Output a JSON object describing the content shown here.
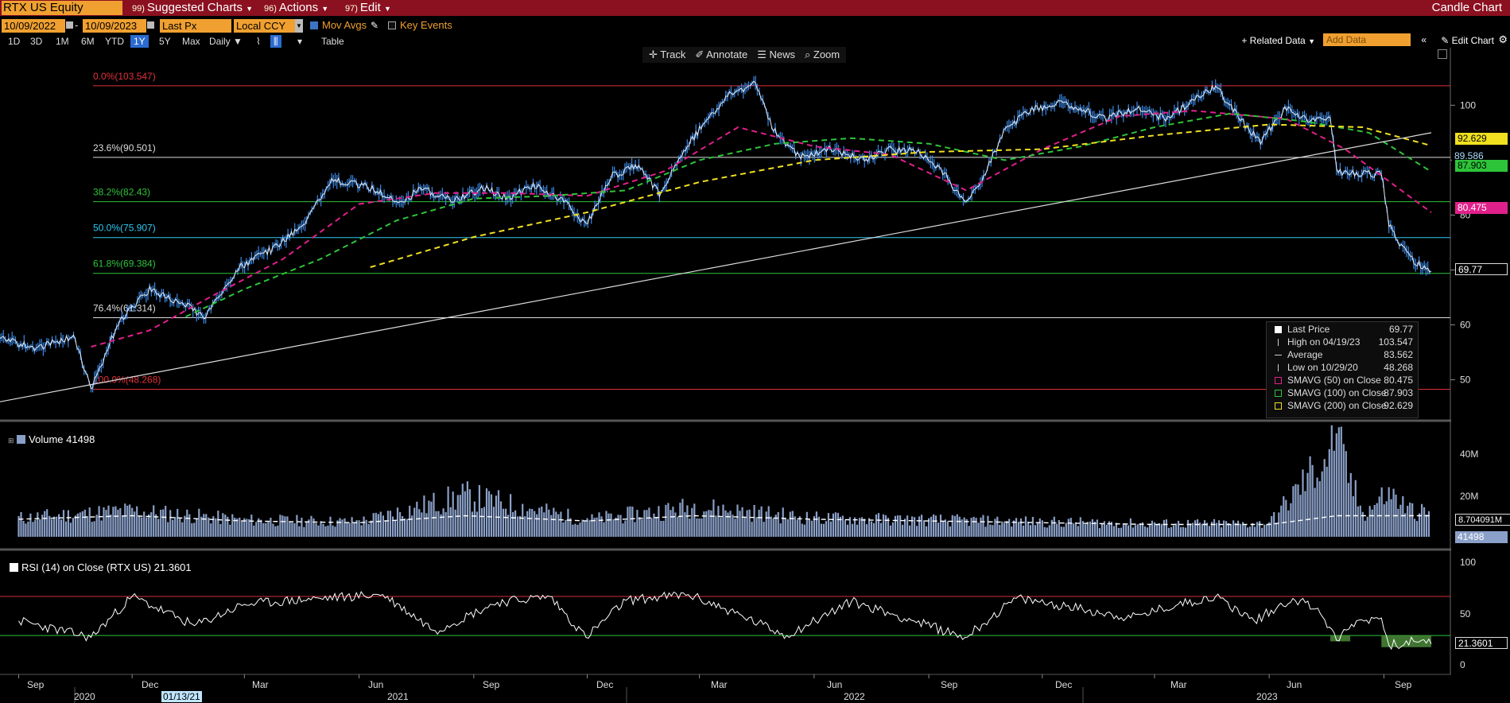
{
  "toolbar": {
    "ticker": "RTX US Equity",
    "menus": [
      {
        "num": "99)",
        "label": "Suggested Charts"
      },
      {
        "num": "96)",
        "label": "Actions"
      },
      {
        "num": "97)",
        "label": "Edit"
      }
    ],
    "chart_type": "Candle Chart",
    "start_date": "10/09/2022",
    "end_date": "10/09/2023",
    "price_field": "Last Px",
    "currency": "Local CCY",
    "mov_avgs": "Mov Avgs",
    "key_events": "Key Events",
    "periods": [
      "1D",
      "3D",
      "1M",
      "6M",
      "YTD",
      "1Y",
      "5Y",
      "Max"
    ],
    "selected_period": "1Y",
    "frequency": "Daily",
    "table_label": "Table",
    "related_data": "+ Related Data",
    "add_data_placeholder": "Add Data",
    "edit_chart": "Edit Chart",
    "tools": [
      "Track",
      "Annotate",
      "News",
      "Zoom"
    ]
  },
  "legend": {
    "rows": [
      {
        "label": "Last Price",
        "value": "69.77",
        "color": "#ffffff"
      },
      {
        "label": "High on 04/19/23",
        "value": "103.547",
        "color": "#cccccc"
      },
      {
        "label": "Average",
        "value": "83.562",
        "color": "#cccccc"
      },
      {
        "label": "Low on 10/29/20",
        "value": "48.268",
        "color": "#cccccc"
      },
      {
        "label": "SMAVG (50)  on Close",
        "value": "80.475",
        "color": "#e0208a"
      },
      {
        "label": "SMAVG (100)  on Close",
        "value": "87.903",
        "color": "#2ec43a"
      },
      {
        "label": "SMAVG (200)  on Close",
        "value": "92.629",
        "color": "#f0e020"
      }
    ]
  },
  "price_tags": [
    {
      "label": "92.629",
      "bg": "#f0e020",
      "fg": "#000000"
    },
    {
      "label": "89.586",
      "bg": "#000000",
      "fg": "#aaddff"
    },
    {
      "label": "87.903",
      "bg": "#2ec43a",
      "fg": "#000000"
    },
    {
      "label": "80.475",
      "bg": "#e0208a",
      "fg": "#ffffff"
    },
    {
      "label": "69.77",
      "bg": "#000000",
      "fg": "#ffffff"
    }
  ],
  "volume_panel": {
    "label": "Volume  41498",
    "tags": [
      "8.704091M",
      "41498"
    ],
    "yticks": [
      "40M",
      "20M"
    ]
  },
  "rsi_panel": {
    "label": "RSI (14)  on Close (RTX US) 21.3601",
    "tag": "21.3601",
    "yticks": [
      "100",
      "50",
      "0"
    ]
  },
  "x_axis": {
    "months": [
      "Sep",
      "Dec",
      "Mar",
      "Jun",
      "Sep",
      "Dec",
      "Mar",
      "Jun",
      "Sep",
      "Dec",
      "Mar",
      "Jun",
      "Sep"
    ],
    "years": [
      "2020",
      "2021",
      "2022",
      "2023"
    ],
    "highlight": "01/13/21"
  },
  "chart_data": {
    "type": "line",
    "title": "RTX US Equity",
    "y_axis_ticks": [
      100,
      90,
      80,
      70,
      60,
      50
    ],
    "ylim": [
      44,
      107
    ],
    "x_range": [
      "2020-08-17",
      "2023-10-09"
    ],
    "price_series": {
      "name": "Last Price",
      "dates": [
        "2020-08-17",
        "2020-09-15",
        "2020-10-15",
        "2020-10-29",
        "2020-11-20",
        "2020-12-15",
        "2021-01-13",
        "2021-01-29",
        "2021-02-25",
        "2021-03-25",
        "2021-04-20",
        "2021-05-10",
        "2021-06-10",
        "2021-07-05",
        "2021-07-20",
        "2021-08-15",
        "2021-09-10",
        "2021-09-28",
        "2021-10-20",
        "2021-11-15",
        "2021-11-30",
        "2021-12-20",
        "2022-01-10",
        "2022-01-28",
        "2022-02-15",
        "2022-03-01",
        "2022-03-25",
        "2022-04-15",
        "2022-04-28",
        "2022-05-20",
        "2022-06-15",
        "2022-07-10",
        "2022-08-01",
        "2022-08-25",
        "2022-09-15",
        "2022-09-30",
        "2022-10-15",
        "2022-10-31",
        "2022-11-20",
        "2022-12-15",
        "2022-12-30",
        "2023-01-20",
        "2023-02-15",
        "2023-03-10",
        "2023-04-19",
        "2023-05-10",
        "2023-05-25",
        "2023-06-15",
        "2023-07-05",
        "2023-07-20",
        "2023-07-25",
        "2023-08-10",
        "2023-08-30",
        "2023-09-05",
        "2023-09-12",
        "2023-09-25",
        "2023-10-09"
      ],
      "values": [
        57.5,
        55.8,
        57.8,
        48.3,
        60.5,
        66.5,
        63.5,
        61.5,
        70.5,
        74.0,
        79.0,
        86.5,
        85.0,
        82.0,
        85.0,
        82.5,
        85.0,
        83.0,
        85.5,
        82.0,
        78.0,
        87.0,
        89.0,
        84.0,
        91.0,
        95.5,
        102.0,
        104.0,
        96.0,
        90.5,
        92.0,
        90.0,
        92.0,
        91.5,
        87.0,
        82.0,
        87.0,
        95.0,
        99.0,
        100.5,
        99.5,
        97.5,
        99.5,
        97.5,
        103.5,
        97.0,
        93.5,
        99.5,
        97.0,
        98.0,
        88.0,
        87.5,
        87.5,
        78.5,
        75.0,
        71.5,
        69.77
      ]
    },
    "overlays": [
      {
        "name": "SMAVG (50) on Close",
        "dates": [
          "2020-10-29",
          "2020-12-15",
          "2021-02-01",
          "2021-04-01",
          "2021-06-01",
          "2021-08-01",
          "2021-10-01",
          "2021-12-01",
          "2022-02-01",
          "2022-04-01",
          "2022-06-01",
          "2022-08-01",
          "2022-10-01",
          "2022-12-01",
          "2023-02-01",
          "2023-04-01",
          "2023-06-15",
          "2023-08-01",
          "2023-10-09"
        ],
        "values": [
          56.0,
          59.0,
          65.0,
          72.0,
          82.0,
          84.0,
          84.0,
          83.5,
          88.0,
          96.0,
          92.5,
          91.0,
          84.5,
          92.0,
          98.0,
          99.0,
          97.5,
          92.0,
          80.475
        ]
      },
      {
        "name": "SMAVG (100) on Close",
        "dates": [
          "2021-01-13",
          "2021-03-01",
          "2021-05-01",
          "2021-07-01",
          "2021-09-01",
          "2021-11-01",
          "2022-01-01",
          "2022-03-01",
          "2022-05-01",
          "2022-07-01",
          "2022-09-01",
          "2022-11-01",
          "2023-01-01",
          "2023-03-01",
          "2023-05-01",
          "2023-07-01",
          "2023-08-20",
          "2023-10-09"
        ],
        "values": [
          61.5,
          66.5,
          72.0,
          79.0,
          83.0,
          83.5,
          84.5,
          90.0,
          93.0,
          94.0,
          93.0,
          90.0,
          92.5,
          96.0,
          98.5,
          97.0,
          95.0,
          87.903
        ]
      },
      {
        "name": "SMAVG (200) on Close",
        "dates": [
          "2021-06-10",
          "2021-09-01",
          "2021-12-01",
          "2022-03-01",
          "2022-06-01",
          "2022-09-01",
          "2022-12-01",
          "2023-03-01",
          "2023-06-01",
          "2023-08-15",
          "2023-10-09"
        ],
        "values": [
          70.5,
          76.0,
          80.5,
          86.0,
          90.0,
          91.5,
          92.0,
          94.5,
          96.5,
          96.0,
          92.629
        ]
      },
      {
        "name": "Trend line",
        "dates": [
          "2020-08-17",
          "2023-10-09"
        ],
        "values": [
          46.0,
          95.0
        ]
      }
    ],
    "fibonacci": [
      {
        "label": "0.0%(103.547)",
        "value": 103.547,
        "color": "#e0303a"
      },
      {
        "label": "23.6%(90.501)",
        "value": 90.501,
        "color": "#dddddd"
      },
      {
        "label": "38.2%(82.43)",
        "value": 82.43,
        "color": "#2ec43a"
      },
      {
        "label": "50.0%(75.907)",
        "value": 75.907,
        "color": "#30c8f0"
      },
      {
        "label": "61.8%(69.384)",
        "value": 69.384,
        "color": "#2ec43a"
      },
      {
        "label": "76.4%(61.314)",
        "value": 61.314,
        "color": "#dddddd"
      },
      {
        "label": "100.0%(48.268)",
        "value": 48.268,
        "color": "#e0303a"
      }
    ],
    "volume": {
      "name": "Volume",
      "ylim": [
        0,
        50
      ],
      "unit": "M",
      "dates": [
        "2020-09-01",
        "2020-12-01",
        "2021-03-01",
        "2021-06-01",
        "2021-08-25",
        "2021-12-01",
        "2022-02-25",
        "2022-06-01",
        "2022-09-01",
        "2022-12-01",
        "2023-03-01",
        "2023-06-01",
        "2023-07-25",
        "2023-08-15",
        "2023-09-05",
        "2023-09-20",
        "2023-10-09"
      ],
      "values": [
        10,
        14,
        9,
        8,
        22,
        9,
        16,
        10,
        9,
        8,
        7,
        7,
        50,
        12,
        24,
        15,
        12
      ],
      "average_label": "8.704091M"
    },
    "rsi": {
      "name": "RSI (14) on Close (RTX US)",
      "ylim": [
        -5,
        110
      ],
      "overbought": 70,
      "oversold": 30,
      "dates": [
        "2020-09-01",
        "2020-10-29",
        "2020-12-01",
        "2021-01-20",
        "2021-03-01",
        "2021-05-01",
        "2021-06-20",
        "2021-08-01",
        "2021-09-20",
        "2021-11-01",
        "2021-11-30",
        "2022-01-01",
        "2022-02-20",
        "2022-03-20",
        "2022-05-10",
        "2022-07-01",
        "2022-08-20",
        "2022-09-30",
        "2022-11-10",
        "2022-12-20",
        "2023-02-10",
        "2023-03-20",
        "2023-04-19",
        "2023-05-20",
        "2023-06-20",
        "2023-07-10",
        "2023-07-25",
        "2023-08-10",
        "2023-08-30",
        "2023-09-05",
        "2023-09-25",
        "2023-10-09"
      ],
      "values": [
        45,
        28,
        70,
        40,
        62,
        68,
        72,
        35,
        64,
        70,
        28,
        66,
        72,
        58,
        30,
        65,
        45,
        28,
        68,
        60,
        48,
        62,
        70,
        45,
        68,
        58,
        25,
        45,
        48,
        20,
        24,
        21.36
      ]
    }
  }
}
